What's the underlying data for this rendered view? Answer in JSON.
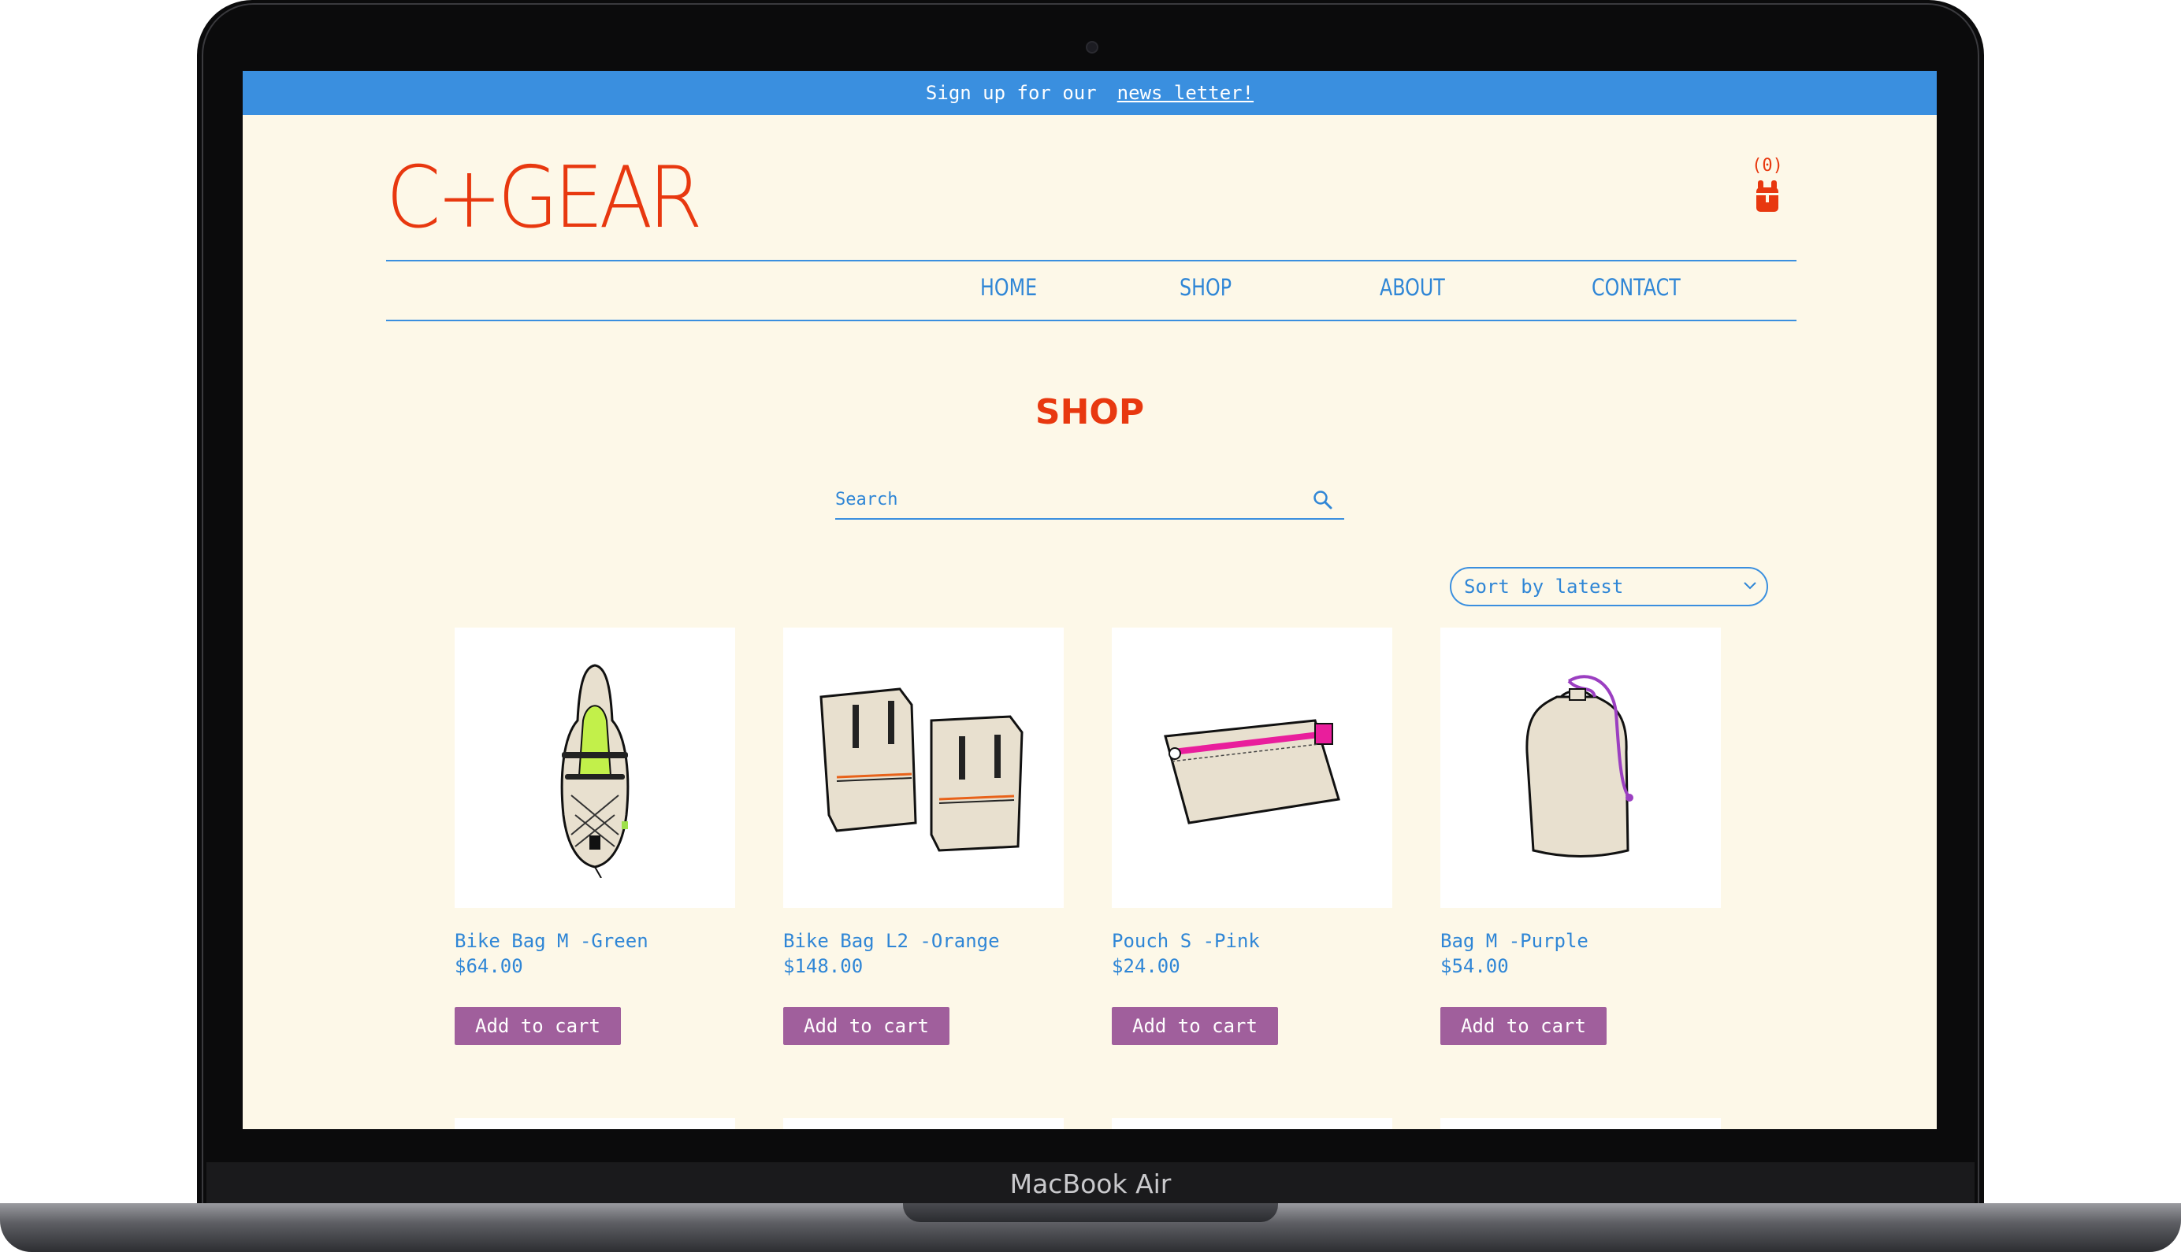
{
  "device": {
    "label": "MacBook Air"
  },
  "promo": {
    "text": "Sign up for our",
    "link": "news letter!"
  },
  "brand": {
    "logo": "C+GEAR",
    "accent": "#e8380f",
    "link_color": "#2f86d6",
    "button_color": "#a05f9c",
    "promo_color": "#3a8fdf",
    "background": "#fdf8e8"
  },
  "cart": {
    "count": "(0)",
    "icon": "backpack-cart-icon"
  },
  "nav": {
    "items": [
      {
        "label": "HOME"
      },
      {
        "label": "SHOP"
      },
      {
        "label": "ABOUT"
      },
      {
        "label": "CONTACT"
      }
    ]
  },
  "page": {
    "title": "SHOP"
  },
  "search": {
    "placeholder": "Search",
    "icon": "search-icon"
  },
  "sort": {
    "selected": "Sort by latest"
  },
  "products": [
    {
      "name": "Bike Bag M -Green",
      "price": "$64.00",
      "button": "Add to cart",
      "image": "green-bike-bag-illustration"
    },
    {
      "name": "Bike Bag L2 -Orange",
      "price": "$148.00",
      "button": "Add to cart",
      "image": "orange-bike-bags-illustration"
    },
    {
      "name": "Pouch S -Pink",
      "price": "$24.00",
      "button": "Add to cart",
      "image": "pink-zip-pouch-illustration"
    },
    {
      "name": "Bag M -Purple",
      "price": "$54.00",
      "button": "Add to cart",
      "image": "purple-drawstring-bag-illustration"
    }
  ]
}
